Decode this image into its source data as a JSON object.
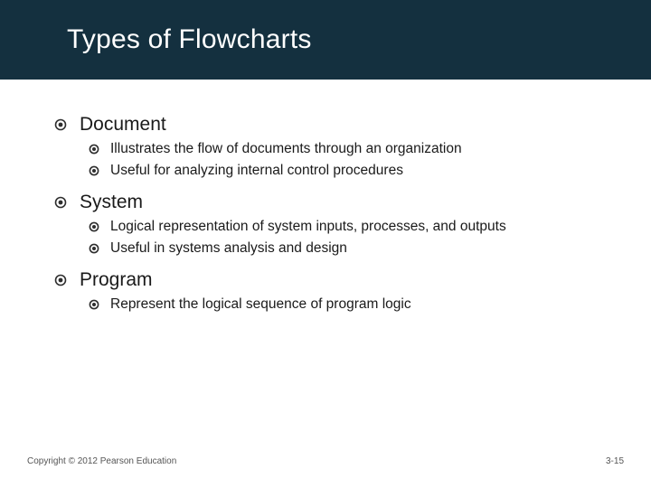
{
  "title": "Types of Flowcharts",
  "sections": [
    {
      "heading": "Document",
      "items": [
        "Illustrates the flow of documents through an organization",
        "Useful for analyzing internal control procedures"
      ]
    },
    {
      "heading": "System",
      "items": [
        "Logical representation of system inputs, processes, and outputs",
        "Useful in systems analysis and design"
      ]
    },
    {
      "heading": "Program",
      "items": [
        "Represent the logical sequence of program logic"
      ]
    }
  ],
  "footer": {
    "copyright": "Copyright © 2012 Pearson Education",
    "page": "3-15"
  }
}
